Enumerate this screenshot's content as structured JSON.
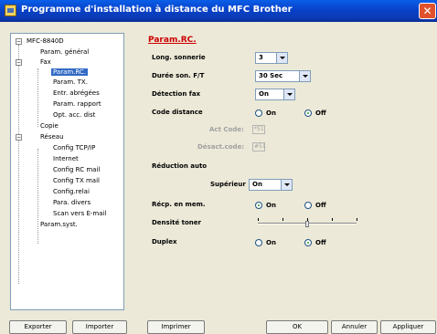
{
  "window": {
    "title": "Programme d'installation à distance du MFC Brother",
    "close_symbol": "✕"
  },
  "tree": {
    "root": "MFC-8840D",
    "items": [
      "Param. général",
      "Fax",
      "Param.RC.",
      "Param. TX.",
      "Entr. abrégées",
      "Param. rapport",
      "Opt. acc. dist",
      "Copie",
      "Réseau",
      "Config TCP/IP",
      "Internet",
      "Config RC mail",
      "Config TX mail",
      "Config.relai",
      "Para. divers",
      "Scan vers E-mail",
      "Param.syst."
    ],
    "selected": "Param.RC."
  },
  "panel": {
    "title": "Param.RC.",
    "ring_count": {
      "label": "Long. sonnerie",
      "value": "3"
    },
    "ft_duration": {
      "label": "Durée son. F/T",
      "value": "30 Sec"
    },
    "fax_detect": {
      "label": "Détection fax",
      "value": "On"
    },
    "remote_code": {
      "label": "Code distance",
      "on": "On",
      "off": "Off",
      "selected": "off"
    },
    "act_code": {
      "label": "Act Code:",
      "value": "*51"
    },
    "deact_code": {
      "label": "Désact.code:",
      "value": "#51"
    },
    "reduction": {
      "label": "Réduction auto",
      "sub_label": "Supérieur",
      "value": "On"
    },
    "mem_receive": {
      "label": "Récp. en mem.",
      "on": "On",
      "off": "Off",
      "selected": "on"
    },
    "toner_density": {
      "label": "Densité toner",
      "level_index": 3,
      "levels": 5
    },
    "duplex": {
      "label": "Duplex",
      "on": "On",
      "off": "Off",
      "selected": "off"
    }
  },
  "buttons": {
    "export": "Exporter",
    "import": "Importer",
    "print": "Imprimer",
    "ok": "OK",
    "cancel": "Annuler",
    "apply": "Appliquer"
  }
}
